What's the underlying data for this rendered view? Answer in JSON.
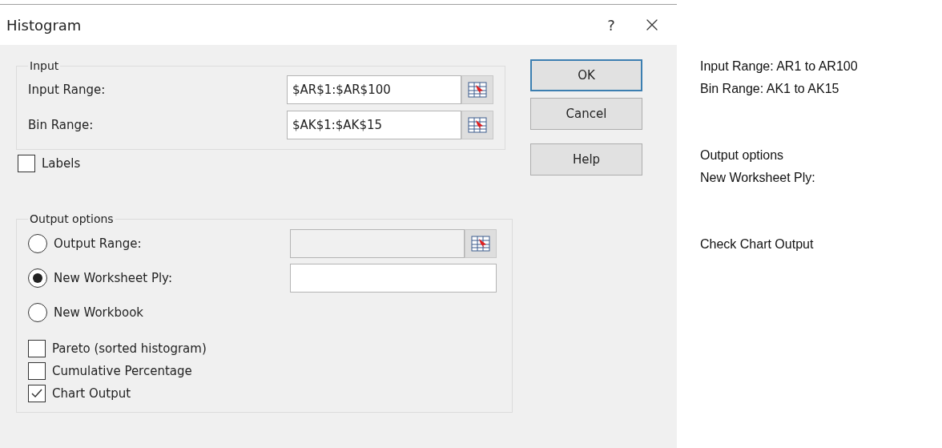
{
  "window": {
    "title": "Histogram",
    "help": "?"
  },
  "input_group": {
    "title": "Input",
    "fields": [
      {
        "label": "Input Range:",
        "value": "$AR$1:$AR$100"
      },
      {
        "label": "Bin Range:",
        "value": "$AK$1:$AK$15"
      }
    ]
  },
  "labels_checkbox": {
    "label": "Labels",
    "checked": false
  },
  "output_group": {
    "title": "Output options",
    "options": [
      {
        "label": "Output Range:",
        "selected": false,
        "field": {
          "kind": "range",
          "disabled": true
        }
      },
      {
        "label": "New Worksheet Ply:",
        "selected": true,
        "field": {
          "kind": "text",
          "disabled": false
        }
      },
      {
        "label": "New Workbook",
        "selected": false
      }
    ],
    "checkboxes": [
      {
        "label": "Pareto (sorted histogram)",
        "checked": false
      },
      {
        "label": "Cumulative Percentage",
        "checked": false
      },
      {
        "label": "Chart Output",
        "checked": true
      }
    ]
  },
  "buttons": [
    {
      "label": "OK",
      "default": true
    },
    {
      "label": "Cancel",
      "default": false
    },
    {
      "label": "Help",
      "default": false
    }
  ],
  "notes": [
    {
      "lines": [
        "Input Range: AR1 to AR100",
        "Bin Range: AK1 to AK15"
      ]
    },
    {
      "lines": [
        "Output options",
        "New Worksheet Ply:"
      ]
    },
    {
      "lines": [
        "Check Chart Output"
      ]
    }
  ]
}
